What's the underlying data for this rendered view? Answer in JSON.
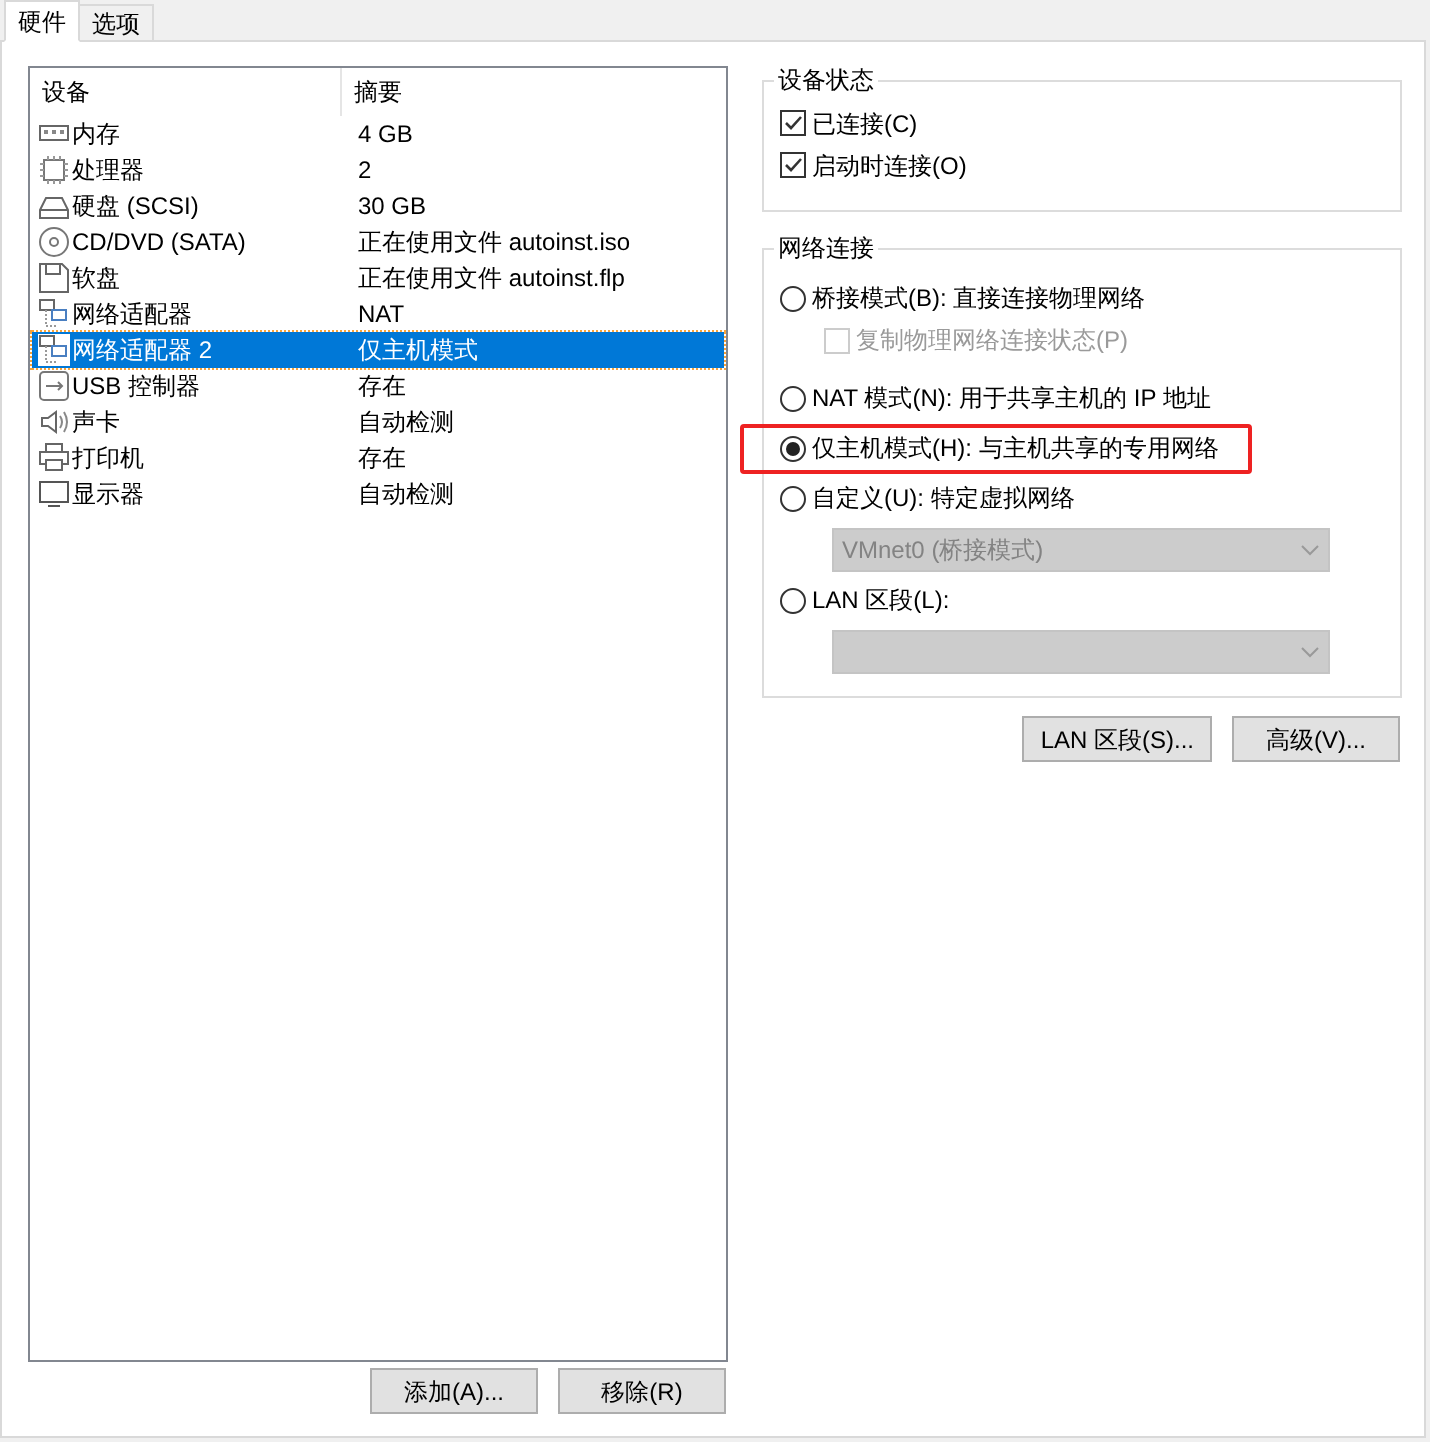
{
  "tabs": [
    {
      "label": "硬件",
      "selected": true
    },
    {
      "label": "选项",
      "selected": false
    }
  ],
  "devices": {
    "columns": [
      "设备",
      "摘要"
    ],
    "rows": [
      {
        "kind": "memory",
        "name": "内存",
        "summary": "4 GB",
        "selected": false
      },
      {
        "kind": "cpu",
        "name": "处理器",
        "summary": "2",
        "selected": false
      },
      {
        "kind": "disk",
        "name": "硬盘 (SCSI)",
        "summary": "30 GB",
        "selected": false
      },
      {
        "kind": "cd",
        "name": "CD/DVD (SATA)",
        "summary": "正在使用文件 autoinst.iso",
        "selected": false
      },
      {
        "kind": "floppy",
        "name": "软盘",
        "summary": "正在使用文件 autoinst.flp",
        "selected": false
      },
      {
        "kind": "network",
        "name": "网络适配器",
        "summary": "NAT",
        "selected": false
      },
      {
        "kind": "network",
        "name": "网络适配器 2",
        "summary": "仅主机模式",
        "selected": true
      },
      {
        "kind": "usb",
        "name": "USB 控制器",
        "summary": "存在",
        "selected": false
      },
      {
        "kind": "sound",
        "name": "声卡",
        "summary": "自动检测",
        "selected": false
      },
      {
        "kind": "printer",
        "name": "打印机",
        "summary": "存在",
        "selected": false
      },
      {
        "kind": "display",
        "name": "显示器",
        "summary": "自动检测",
        "selected": false
      }
    ]
  },
  "device_status": {
    "title": "设备状态",
    "items": [
      {
        "label": "已连接(C)",
        "checked": true
      },
      {
        "label": "启动时连接(O)",
        "checked": true
      }
    ]
  },
  "network_connection": {
    "title": "网络连接",
    "items": [
      {
        "kind": "radio",
        "label": "桥接模式(B): 直接连接物理网络",
        "selected": false,
        "highlighted": false
      },
      {
        "kind": "checkbox",
        "label": "复制物理网络连接状态(P)",
        "checked": false,
        "disabled": true
      },
      {
        "kind": "radio",
        "label": "NAT 模式(N): 用于共享主机的 IP 地址",
        "selected": false,
        "highlighted": false
      },
      {
        "kind": "radio",
        "label": "仅主机模式(H): 与主机共享的专用网络",
        "selected": true,
        "highlighted": true
      },
      {
        "kind": "radio",
        "label": "自定义(U): 特定虚拟网络",
        "selected": false,
        "highlighted": false
      },
      {
        "kind": "select",
        "value": "VMnet0 (桥接模式)",
        "disabled": true
      },
      {
        "kind": "radio",
        "label": "LAN 区段(L):",
        "selected": false,
        "highlighted": false
      },
      {
        "kind": "select",
        "disabled": true
      }
    ]
  },
  "right_buttons": [
    "LAN 区段(S)...",
    "高级(V)..."
  ],
  "bottom_buttons": [
    "添加(A)...",
    "移除(R)"
  ]
}
